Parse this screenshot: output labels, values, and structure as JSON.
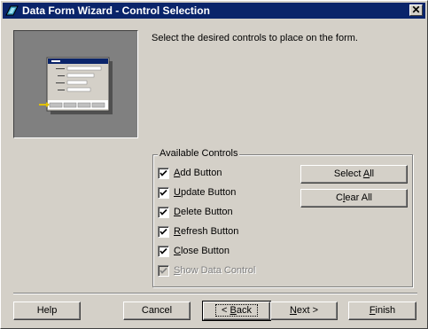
{
  "window": {
    "title": "Data Form Wizard - Control Selection",
    "close_glyph": "✕"
  },
  "instruction": "Select the desired controls to place on the form.",
  "group": {
    "label": "Available Controls",
    "items": [
      {
        "pre": "",
        "mnemonic": "A",
        "post": "dd Button",
        "checked": true,
        "enabled": true
      },
      {
        "pre": "",
        "mnemonic": "U",
        "post": "pdate Button",
        "checked": true,
        "enabled": true
      },
      {
        "pre": "",
        "mnemonic": "D",
        "post": "elete Button",
        "checked": true,
        "enabled": true
      },
      {
        "pre": "",
        "mnemonic": "R",
        "post": "efresh Button",
        "checked": true,
        "enabled": true
      },
      {
        "pre": "",
        "mnemonic": "C",
        "post": "lose Button",
        "checked": true,
        "enabled": true
      },
      {
        "pre": "",
        "mnemonic": "S",
        "post": "how Data Control",
        "checked": true,
        "enabled": false
      }
    ],
    "select_all": {
      "pre": "Select ",
      "mnemonic": "A",
      "post": "ll"
    },
    "clear_all": {
      "pre": "C",
      "mnemonic": "l",
      "post": "ear All"
    }
  },
  "buttons": {
    "help": "Help",
    "cancel": "Cancel",
    "back": {
      "pre": "< ",
      "mnemonic": "B",
      "post": "ack"
    },
    "next": {
      "pre": "",
      "mnemonic": "N",
      "post": "ext >"
    },
    "finish": {
      "pre": "",
      "mnemonic": "F",
      "post": "inish"
    }
  },
  "colors": {
    "titlebar": "#0a246a",
    "face": "#d4d0c8"
  },
  "icons": {
    "title": "wizard-app-icon",
    "preview": "form-preview-illustration",
    "checkmark": "checkmark-icon"
  }
}
